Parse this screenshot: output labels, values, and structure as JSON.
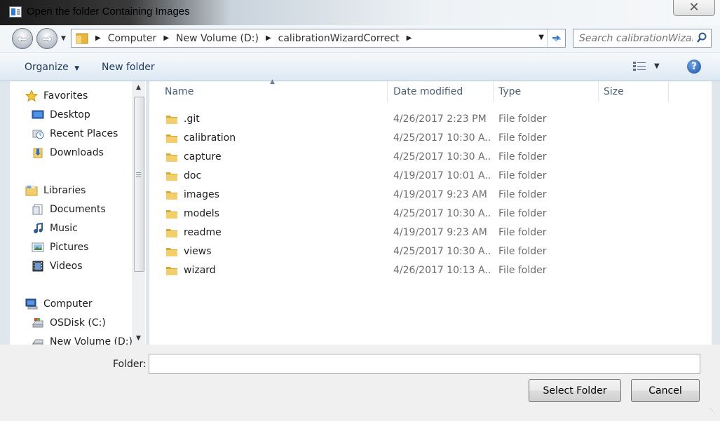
{
  "window": {
    "title": "Open the folder Containing Images",
    "close_label": "✕"
  },
  "address": {
    "crumbs": [
      "Computer",
      "New Volume (D:)",
      "calibrationWizardCorrect"
    ]
  },
  "search": {
    "placeholder": "Search calibrationWizar..."
  },
  "toolbar": {
    "organize_label": "Organize",
    "new_folder_label": "New folder"
  },
  "nav": {
    "favorites": {
      "label": "Favorites",
      "items": [
        "Desktop",
        "Recent Places",
        "Downloads"
      ]
    },
    "libraries": {
      "label": "Libraries",
      "items": [
        "Documents",
        "Music",
        "Pictures",
        "Videos"
      ]
    },
    "computer": {
      "label": "Computer",
      "items": [
        "OSDisk (C:)",
        "New Volume (D:)"
      ]
    }
  },
  "columns": {
    "name": "Name",
    "date": "Date modified",
    "type": "Type",
    "size": "Size"
  },
  "files": [
    {
      "name": ".git",
      "date": "4/26/2017 2:23 PM",
      "type": "File folder"
    },
    {
      "name": "calibration",
      "date": "4/25/2017 10:30 A...",
      "type": "File folder"
    },
    {
      "name": "capture",
      "date": "4/25/2017 10:30 A...",
      "type": "File folder"
    },
    {
      "name": "doc",
      "date": "4/19/2017 10:01 A...",
      "type": "File folder"
    },
    {
      "name": "images",
      "date": "4/19/2017 9:23 AM",
      "type": "File folder"
    },
    {
      "name": "models",
      "date": "4/25/2017 10:30 A...",
      "type": "File folder"
    },
    {
      "name": "readme",
      "date": "4/19/2017 9:23 AM",
      "type": "File folder"
    },
    {
      "name": "views",
      "date": "4/25/2017 10:30 A...",
      "type": "File folder"
    },
    {
      "name": "wizard",
      "date": "4/26/2017 10:13 A...",
      "type": "File folder"
    }
  ],
  "bottom": {
    "folder_label": "Folder:",
    "folder_value": "",
    "select_button": "Select Folder",
    "cancel_button": "Cancel"
  },
  "colors": {
    "toolbar_text": "#1e395b",
    "column_header_text": "#4c607a",
    "folder_yellow": "#f2cf6a"
  }
}
